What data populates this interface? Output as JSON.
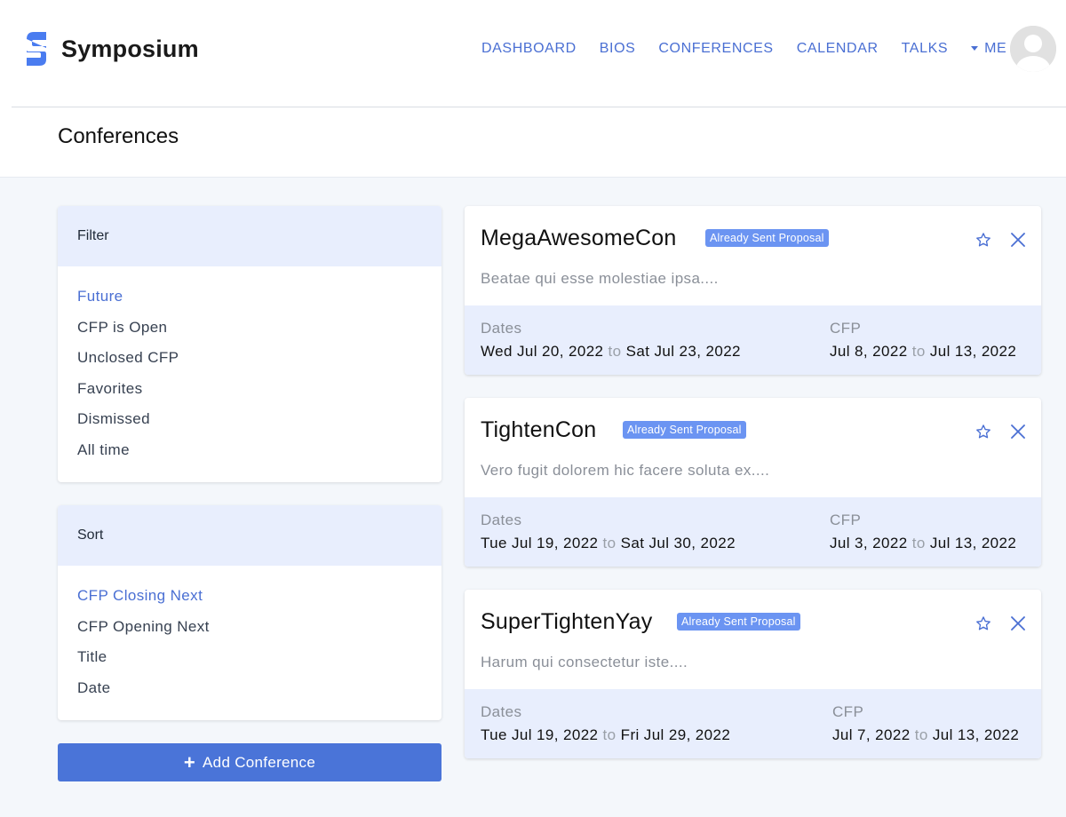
{
  "brand": {
    "name": "Symposium",
    "color": "#4a7cf0"
  },
  "nav": {
    "items": [
      {
        "label": "DASHBOARD"
      },
      {
        "label": "BIOS"
      },
      {
        "label": "CONFERENCES"
      },
      {
        "label": "CALENDAR"
      },
      {
        "label": "TALKS"
      }
    ],
    "me_label": "ME"
  },
  "page": {
    "title": "Conferences"
  },
  "filter": {
    "heading": "Filter",
    "items": [
      {
        "label": "Future",
        "active": true
      },
      {
        "label": "CFP is Open",
        "active": false
      },
      {
        "label": "Unclosed CFP",
        "active": false
      },
      {
        "label": "Favorites",
        "active": false
      },
      {
        "label": "Dismissed",
        "active": false
      },
      {
        "label": "All time",
        "active": false
      }
    ]
  },
  "sort": {
    "heading": "Sort",
    "items": [
      {
        "label": "CFP Closing Next",
        "active": true
      },
      {
        "label": "CFP Opening Next",
        "active": false
      },
      {
        "label": "Title",
        "active": false
      },
      {
        "label": "Date",
        "active": false
      }
    ]
  },
  "add_button": {
    "label": "Add Conference"
  },
  "labels": {
    "dates": "Dates",
    "cfp": "CFP",
    "to": "to"
  },
  "conferences": [
    {
      "title": "MegaAwesomeCon",
      "badge": "Already Sent Proposal",
      "description": "Beatae qui esse molestiae ipsa....",
      "dates_start": "Wed Jul 20, 2022",
      "dates_end": "Sat Jul 23, 2022",
      "cfp_start": "Jul 8, 2022",
      "cfp_end": "Jul 13, 2022"
    },
    {
      "title": "TightenCon",
      "badge": "Already Sent Proposal",
      "description": "Vero fugit dolorem hic facere soluta ex....",
      "dates_start": "Tue Jul 19, 2022",
      "dates_end": "Sat Jul 30, 2022",
      "cfp_start": "Jul 3, 2022",
      "cfp_end": "Jul 13, 2022"
    },
    {
      "title": "SuperTightenYay",
      "badge": "Already Sent Proposal",
      "description": "Harum qui consectetur iste....",
      "dates_start": "Tue Jul 19, 2022",
      "dates_end": "Fri Jul 29, 2022",
      "cfp_start": "Jul 7, 2022",
      "cfp_end": "Jul 13, 2022"
    }
  ],
  "icons": {
    "logo": "symposium-logo-icon",
    "caret": "caret-down-icon",
    "avatar": "avatar-placeholder-icon",
    "favorite": "star-outline-icon",
    "dismiss": "close-x-icon",
    "add": "plus-icon"
  },
  "colors": {
    "accent": "#4a6fd3",
    "button": "#4a74d8",
    "badge": "#6b94f2",
    "panel_header": "#e8eefd"
  }
}
